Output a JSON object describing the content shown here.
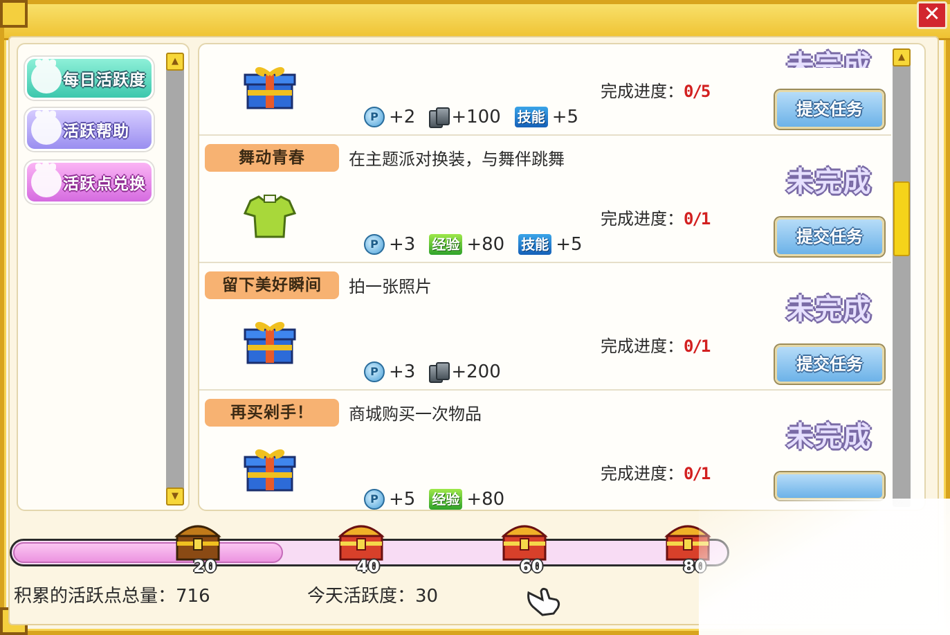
{
  "window": {
    "close_label": "✕"
  },
  "sidebar": {
    "items": [
      {
        "label": "每日活跃度"
      },
      {
        "label": "活跃帮助"
      },
      {
        "label": "活跃点兑换"
      }
    ]
  },
  "tasks": [
    {
      "title": "",
      "description": "",
      "progress_label": "完成进度：",
      "progress": "0/5",
      "status": "未完成",
      "submit": "提交任务",
      "rewards": [
        {
          "kind": "activity",
          "amount": "+2"
        },
        {
          "kind": "coins",
          "amount": "+100"
        },
        {
          "kind": "skill",
          "badge": "技能",
          "amount": "+5"
        }
      ]
    },
    {
      "title": "舞动青春",
      "description": "在主题派对换装，与舞伴跳舞",
      "progress_label": "完成进度：",
      "progress": "0/1",
      "status": "未完成",
      "submit": "提交任务",
      "rewards": [
        {
          "kind": "activity",
          "amount": "+3"
        },
        {
          "kind": "exp",
          "badge": "经验",
          "amount": "+80"
        },
        {
          "kind": "skill",
          "badge": "技能",
          "amount": "+5"
        }
      ]
    },
    {
      "title": "留下美好瞬间",
      "description": "拍一张照片",
      "progress_label": "完成进度：",
      "progress": "0/1",
      "status": "未完成",
      "submit": "提交任务",
      "rewards": [
        {
          "kind": "activity",
          "amount": "+3"
        },
        {
          "kind": "coins",
          "amount": "+200"
        }
      ]
    },
    {
      "title": "再买剁手！",
      "description": "商城购买一次物品",
      "progress_label": "完成进度：",
      "progress": "0/1",
      "status": "未完成",
      "submit": "",
      "rewards": [
        {
          "kind": "activity",
          "amount": "+5"
        },
        {
          "kind": "exp",
          "badge": "经验",
          "amount": "+80"
        }
      ]
    }
  ],
  "activity_bar": {
    "current": 30,
    "max": 80,
    "milestones": [
      "20",
      "40",
      "60",
      "80"
    ]
  },
  "footer": {
    "total_points_label": "积累的活跃点总量：",
    "total_points_value": "716",
    "today_label": "今天活跃度：",
    "today_value": "30"
  },
  "colors": {
    "frame_gold": "#d8a41e",
    "progress_red": "#d22020",
    "tag_orange": "#f7b272",
    "submit_blue": "#6cb2e8"
  }
}
